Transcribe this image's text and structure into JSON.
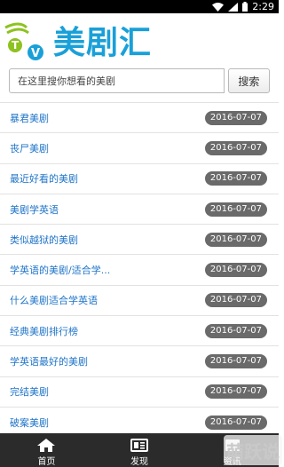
{
  "status_bar": {
    "time": "2:29"
  },
  "app": {
    "logo_text": "美剧汇",
    "brand_color": "#1aa0d8"
  },
  "search": {
    "placeholder": "在这里搜你想看的美剧",
    "button_label": "搜索"
  },
  "list": [
    {
      "title": "暴君美剧",
      "date": "2016-07-07"
    },
    {
      "title": "丧尸美剧",
      "date": "2016-07-07"
    },
    {
      "title": "最近好看的美剧",
      "date": "2016-07-07"
    },
    {
      "title": "美剧学英语",
      "date": "2016-07-07"
    },
    {
      "title": "类似越狱的美剧",
      "date": "2016-07-07"
    },
    {
      "title": "学英语的美剧/适合学...",
      "date": "2016-07-07"
    },
    {
      "title": "什么美剧适合学英语",
      "date": "2016-07-07"
    },
    {
      "title": "经典美剧排行榜",
      "date": "2016-07-07"
    },
    {
      "title": "学英语最好的美剧",
      "date": "2016-07-07"
    },
    {
      "title": "完结美剧",
      "date": "2016-07-07"
    },
    {
      "title": "破案美剧",
      "date": "2016-07-07"
    }
  ],
  "tabs": [
    {
      "label": "首页",
      "icon": "home-icon"
    },
    {
      "label": "发现",
      "icon": "discover-icon"
    },
    {
      "label": "资讯",
      "icon": "news-icon"
    }
  ],
  "watermark": "萌跃说"
}
